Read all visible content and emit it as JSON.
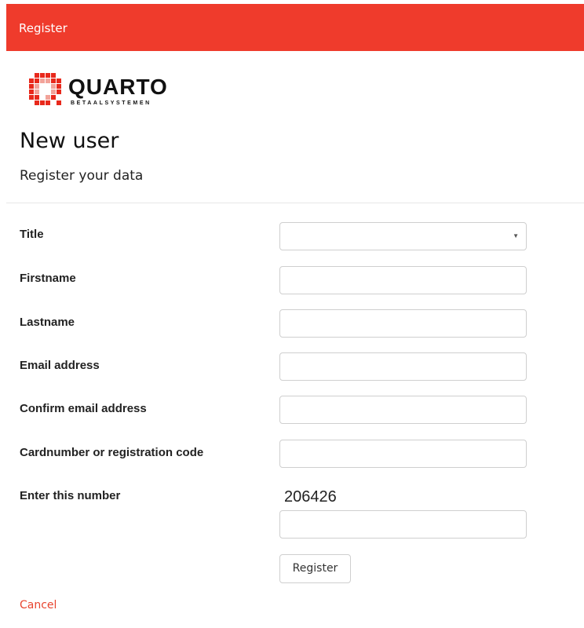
{
  "header": {
    "title": "Register",
    "color": "#ef3b2c"
  },
  "logo": {
    "word": "QUARTO",
    "subtitle": "BETAALSYSTEMEN"
  },
  "page": {
    "heading": "New user",
    "subheading": "Register your data"
  },
  "form": {
    "fields": [
      {
        "label": "Title",
        "type": "select",
        "value": ""
      },
      {
        "label": "Firstname",
        "type": "text",
        "value": ""
      },
      {
        "label": "Lastname",
        "type": "text",
        "value": ""
      },
      {
        "label": "Email address",
        "type": "text",
        "value": ""
      },
      {
        "label": "Confirm email address",
        "type": "text",
        "value": ""
      },
      {
        "label": "Cardnumber or registration code",
        "type": "text",
        "value": ""
      },
      {
        "label": "Enter this number",
        "type": "text",
        "value": ""
      }
    ],
    "captcha_number": "206426",
    "register_label": "Register",
    "cancel_label": "Cancel"
  }
}
